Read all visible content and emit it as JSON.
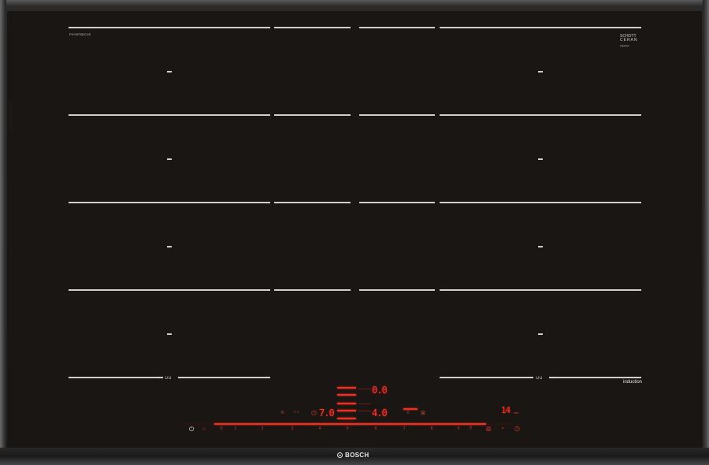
{
  "product": {
    "model_number": "PXY875DC1E",
    "glass_brand_line1": "SCHOTT",
    "glass_brand_line2": "CERAN",
    "glass_brand_line3": "induction",
    "type_label": "induction",
    "brand": "BOSCH",
    "flex_mark": "∪∪"
  },
  "displays": {
    "left_zone_level": "7.0",
    "center_top_level": "0.0",
    "center_level": "4.0",
    "timer": "14",
    "timer_unit": "min"
  },
  "power_scale": {
    "labels": [
      "0",
      "1",
      "2",
      "3",
      "4",
      "5",
      "6",
      "7",
      "8",
      "9"
    ],
    "active_fraction": 0.83
  },
  "icons": {
    "power": "power-icon",
    "child_lock": "childlock-icon",
    "boost": "boost-icon",
    "timer": "timer-icon",
    "stopwatch": "stopwatch-icon",
    "keep_warm": "keep-warm-icon",
    "frying_sensor": "frying-sensor-icon",
    "move": "move-function-icon"
  },
  "colors": {
    "glass": "#1a1614",
    "display_red": "#ff3326",
    "marking": "#cfcfcf"
  }
}
